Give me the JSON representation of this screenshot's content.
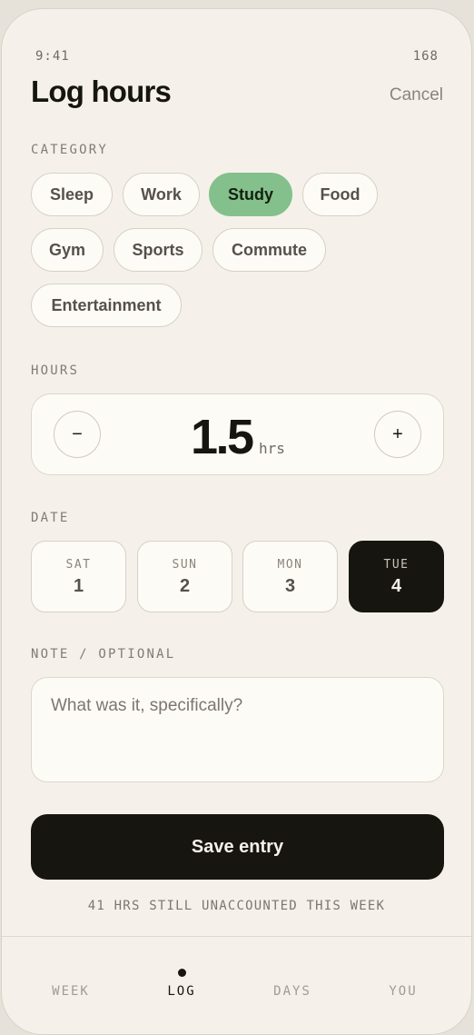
{
  "status": {
    "time": "9:41",
    "right": "168"
  },
  "header": {
    "title": "Log hours",
    "cancel": "Cancel"
  },
  "category": {
    "label": "CATEGORY",
    "selected": "Study",
    "items": [
      "Sleep",
      "Work",
      "Study",
      "Food",
      "Gym",
      "Sports",
      "Commute",
      "Entertainment"
    ]
  },
  "hours": {
    "label": "HOURS",
    "decrement": "−",
    "value": "1.5",
    "unit": "hrs",
    "increment": "+"
  },
  "date": {
    "label": "DATE",
    "selected": 3,
    "days": [
      {
        "dow": "SAT",
        "num": "1"
      },
      {
        "dow": "SUN",
        "num": "2"
      },
      {
        "dow": "MON",
        "num": "3"
      },
      {
        "dow": "TUE",
        "num": "4"
      }
    ]
  },
  "note": {
    "label": "NOTE / OPTIONAL",
    "placeholder": "What was it, specifically?",
    "value": ""
  },
  "save": {
    "label": "Save entry"
  },
  "footnote": "41 HRS STILL UNACCOUNTED THIS WEEK",
  "tabbar": {
    "active": "LOG",
    "items": [
      "WEEK",
      "LOG",
      "DAYS",
      "YOU"
    ]
  },
  "colors": {
    "accent": "#84c08c",
    "ink": "#17150f",
    "paper": "#f5f1ea"
  }
}
